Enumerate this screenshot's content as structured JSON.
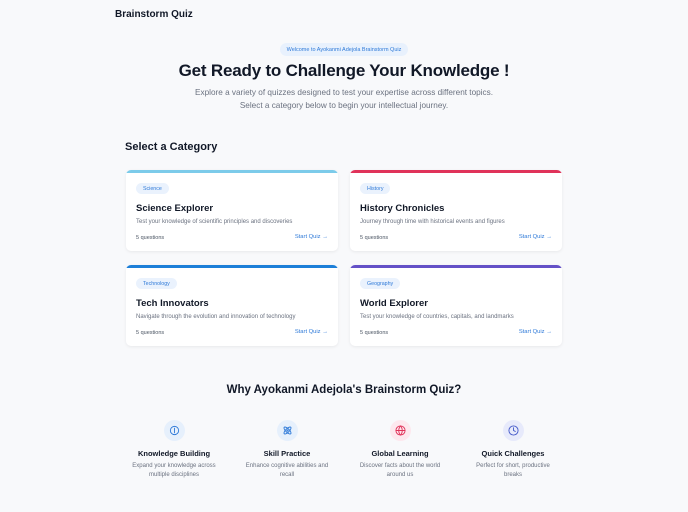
{
  "header": {
    "brand": "Brainstorm Quiz"
  },
  "hero": {
    "welcome_pill": "Welcome to Ayokanmi Adejola Brainstorm Quiz",
    "title": "Get Ready to Challenge Your Knowledge !",
    "subtitle": "Explore a variety of quizzes designed to test your expertise across different topics. Select a category below to begin your intellectual journey."
  },
  "categories": {
    "heading": "Select a Category",
    "items": [
      {
        "tag": "Science",
        "title": "Science Explorer",
        "description": "Test your knowledge of scientific principles and discoveries",
        "count": "5 questions",
        "action": "Start Quiz →",
        "color": "#7ccbea"
      },
      {
        "tag": "History",
        "title": "History Chronicles",
        "description": "Journey through time with historical events and figures",
        "count": "5 questions",
        "action": "Start Quiz →",
        "color": "#e0335a"
      },
      {
        "tag": "Technology",
        "title": "Tech Innovators",
        "description": "Navigate through the evolution and innovation of technology",
        "count": "5 questions",
        "action": "Start Quiz →",
        "color": "#1d7fd8"
      },
      {
        "tag": "Geography",
        "title": "World Explorer",
        "description": "Test your knowledge of countries, capitals, and landmarks",
        "count": "5 questions",
        "action": "Start Quiz →",
        "color": "#6451c7"
      }
    ]
  },
  "why": {
    "heading": "Why Ayokanmi Adejola's Brainstorm Quiz?",
    "features": [
      {
        "icon": "lightbulb-icon",
        "title": "Knowledge Building",
        "description": "Expand your knowledge across multiple disciplines",
        "color": "#2f7ad8",
        "bg": "#e6f0fc"
      },
      {
        "icon": "atom-icon",
        "title": "Skill Practice",
        "description": "Enhance cognitive abilities and recall",
        "color": "#2f7ad8",
        "bg": "#e6f0fc"
      },
      {
        "icon": "globe-icon",
        "title": "Global Learning",
        "description": "Discover facts about the world around us",
        "color": "#e0335a",
        "bg": "#fde8ee"
      },
      {
        "icon": "clock-icon",
        "title": "Quick Challenges",
        "description": "Perfect for short, productive breaks",
        "color": "#4459c9",
        "bg": "#e7eafb"
      }
    ]
  }
}
